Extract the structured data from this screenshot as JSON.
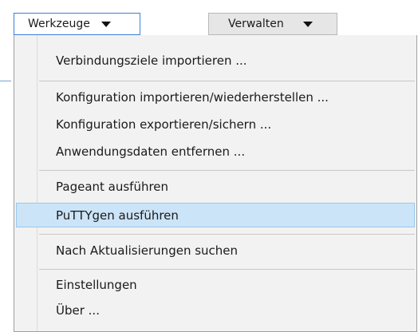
{
  "toolbar": {
    "werkzeuge_label": "Werkzeuge",
    "verwalten_label": "Verwalten"
  },
  "menu": {
    "items": [
      "Verbindungsziele importieren ...",
      "Konfiguration importieren/wiederherstellen ...",
      "Konfiguration exportieren/sichern ...",
      "Anwendungsdaten entfernen ...",
      "Pageant ausführen",
      "PuTTYgen ausführen",
      "Nach Aktualisierungen suchen",
      "Einstellungen",
      "Über ..."
    ],
    "highlighted_item": "PuTTYgen ausführen"
  },
  "colors": {
    "highlight_bg": "#cce4f7",
    "highlight_border": "#99c8ef",
    "active_button_border": "#3c7fd8"
  }
}
